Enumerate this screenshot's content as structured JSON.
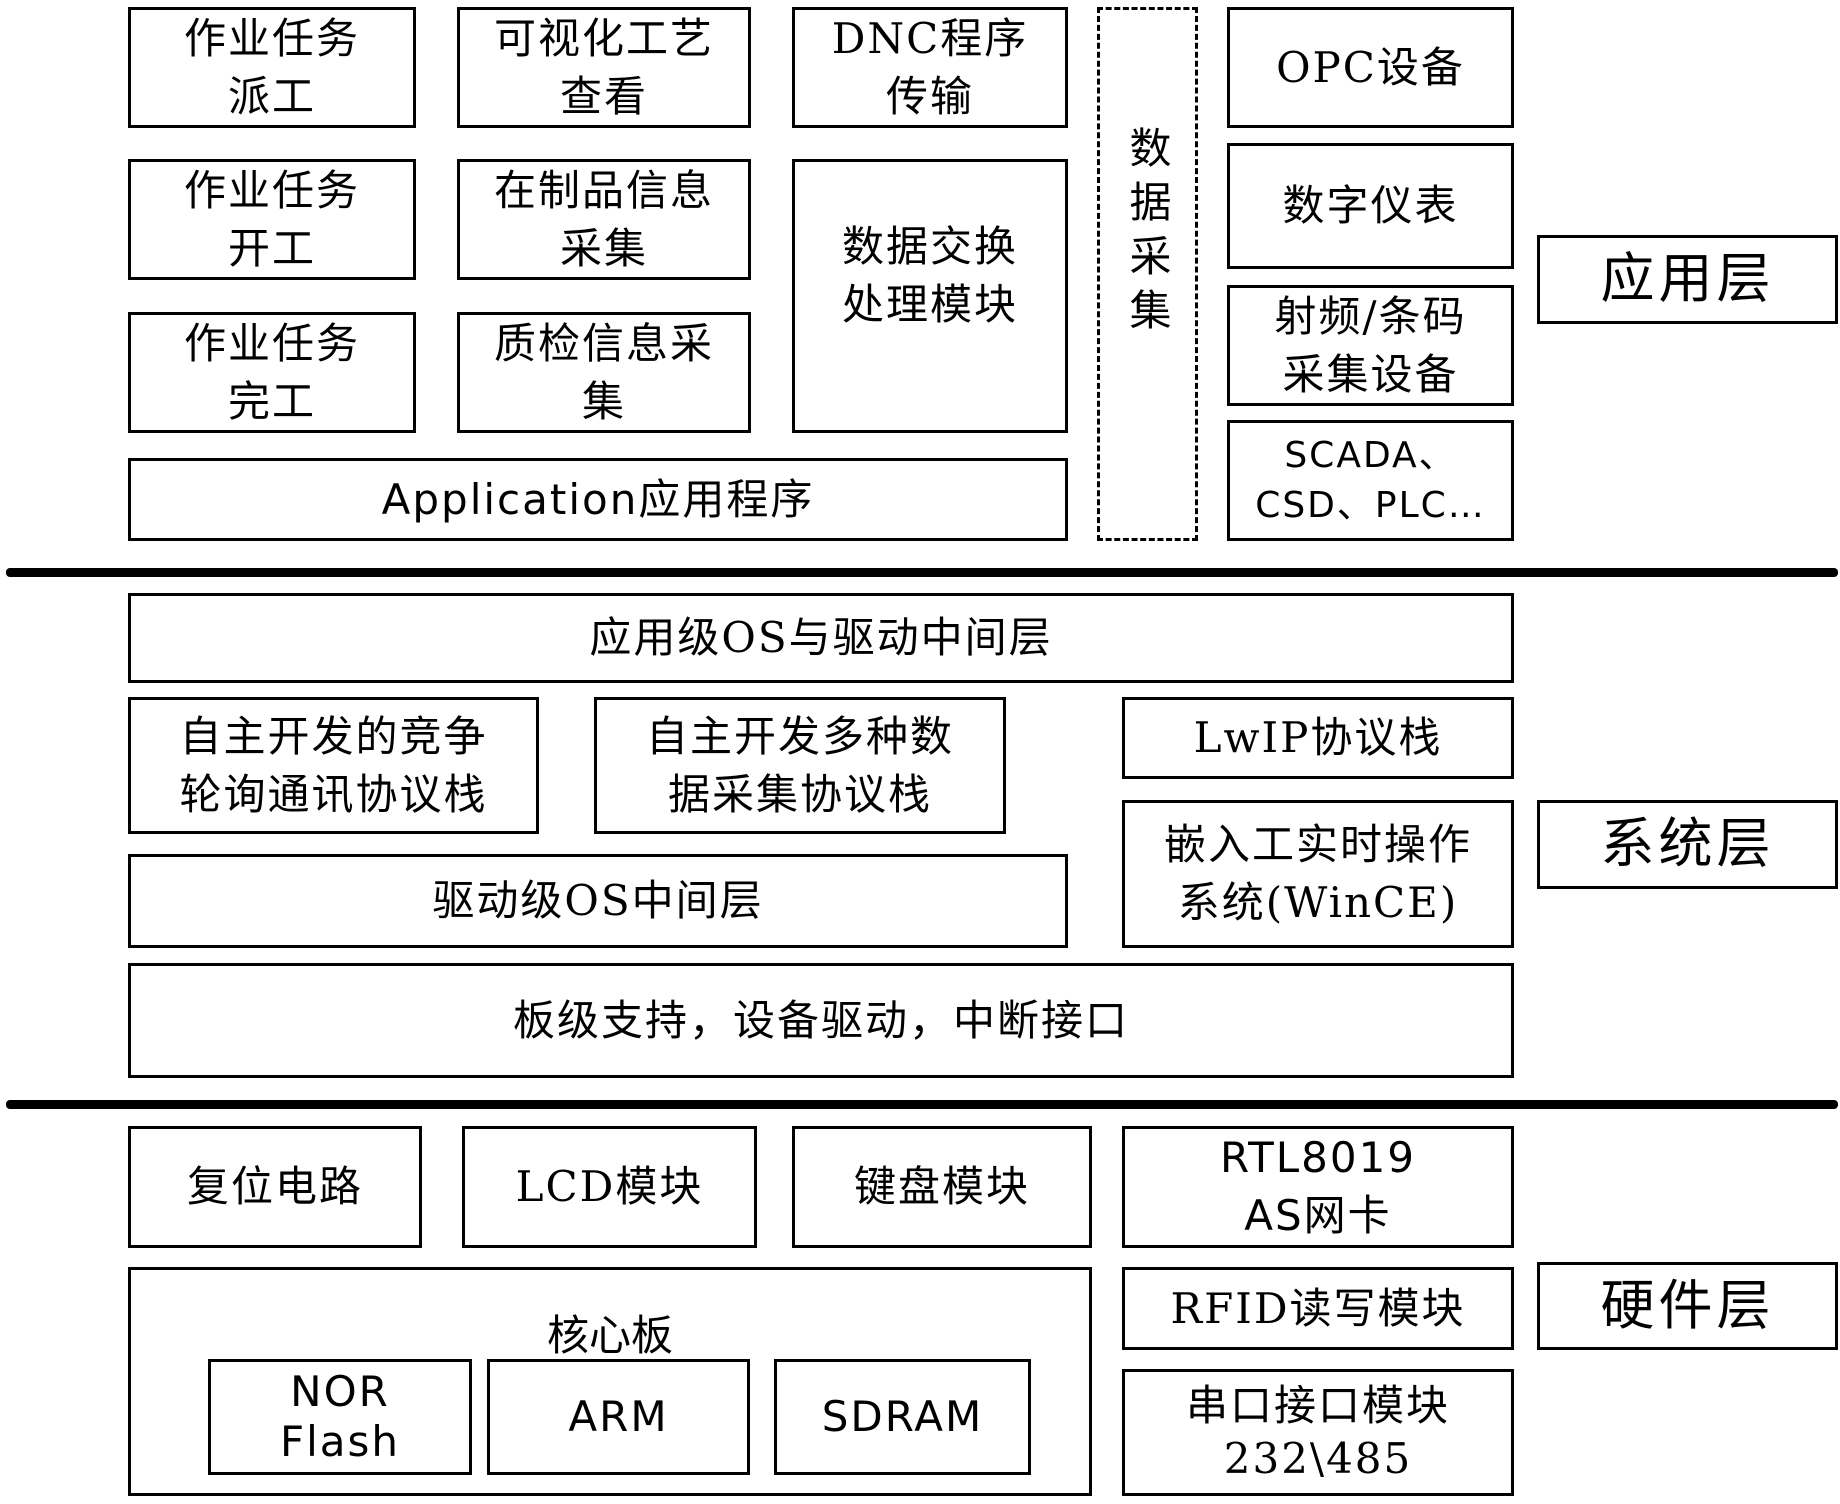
{
  "layers": {
    "application": {
      "label": "应用层",
      "modules": {
        "task_dispatch": "作业任务\n派工",
        "visual_process": "可视化工艺\n查看",
        "dnc_transfer": "DNC程序\n传输",
        "task_start": "作业任务\n开工",
        "wip_info": "在制品信息\n采集",
        "data_exchange": "数据交换\n处理模块",
        "task_finish": "作业任务\n完工",
        "qc_info": "质检信息采\n集",
        "application_program": "Application应用程序"
      },
      "data_acquisition": "数据采集",
      "devices": [
        "OPC设备",
        "数字仪表",
        "射频/条码\n采集设备",
        "SCADA、\nCSD、PLC…"
      ]
    },
    "system": {
      "label": "系统层",
      "modules": {
        "app_os_middleware": "应用级OS与驱动中间层",
        "polling_stack": "自主开发的竞争\n轮询通讯协议栈",
        "acq_stack": "自主开发多种数\n据采集协议栈",
        "lwip_stack": "LwIP协议栈",
        "rtos": "嵌入工实时操作\n系统(WinCE)",
        "driver_os_middleware": "驱动级OS中间层",
        "bsp": "板级支持，设备驱动，中断接口"
      }
    },
    "hardware": {
      "label": "硬件层",
      "modules": {
        "reset_circuit": "复位电路",
        "lcd": "LCD模块",
        "keyboard": "键盘模块",
        "nic": "RTL8019\nAS网卡",
        "core_board": "核心板",
        "nor_flash": "NOR\nFlash",
        "arm": "ARM",
        "sdram": "SDRAM",
        "rfid": "RFID读写模块",
        "serial": "串口接口模块\n232\\485"
      }
    }
  }
}
